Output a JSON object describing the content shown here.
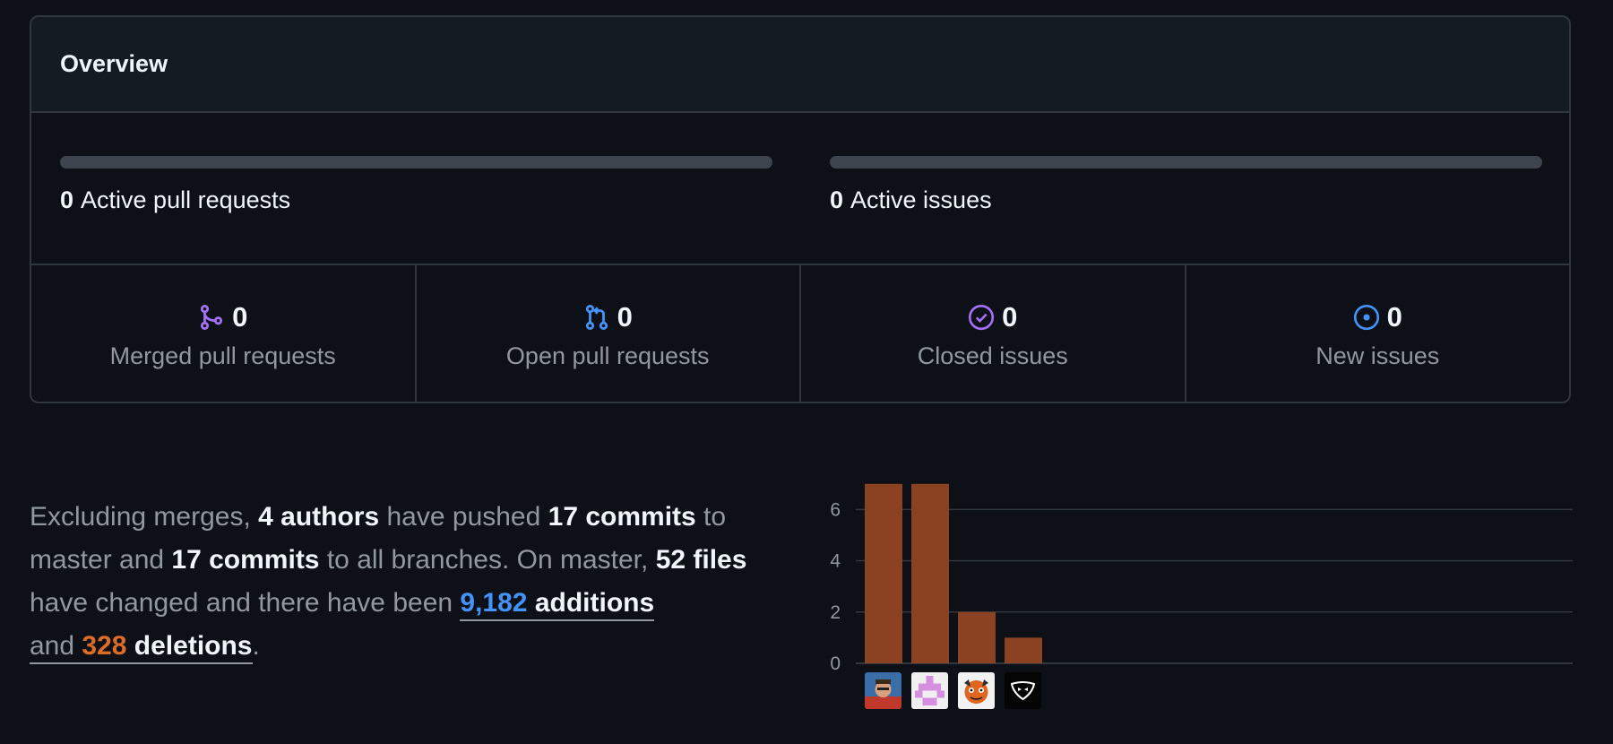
{
  "overview": {
    "title": "Overview",
    "pull_requests": {
      "count": "0",
      "label": "Active pull requests",
      "progress": 0
    },
    "issues": {
      "count": "0",
      "label": "Active issues",
      "progress": 0
    },
    "stats": [
      {
        "icon": "merged-pr-icon",
        "count": "0",
        "label": "Merged pull requests",
        "color": "#a371f7"
      },
      {
        "icon": "open-pr-icon",
        "count": "0",
        "label": "Open pull requests",
        "color": "#4493f8"
      },
      {
        "icon": "closed-issue-icon",
        "count": "0",
        "label": "Closed issues",
        "color": "#a371f7"
      },
      {
        "icon": "new-issue-icon",
        "count": "0",
        "label": "New issues",
        "color": "#4493f8"
      }
    ]
  },
  "summary": {
    "t1": "Excluding merges, ",
    "authors": "4 authors",
    "t2": " have pushed ",
    "commits_master": "17 commits",
    "t3": " to master and ",
    "commits_all": "17 commits",
    "t4": " to all branches. On master, ",
    "files": "52 files",
    "t5": " have changed and there have been ",
    "additions_num": "9,182",
    "additions_word": "additions",
    "t6": "and ",
    "deletions_num": "328",
    "deletions_word": "deletions",
    "t7": "."
  },
  "chart_data": {
    "type": "bar",
    "values": [
      7,
      7,
      2,
      1
    ],
    "yticks": [
      "0",
      "2",
      "4",
      "6"
    ],
    "ylim": [
      0,
      7
    ],
    "bar_color": "#8b4222",
    "grid": true
  }
}
